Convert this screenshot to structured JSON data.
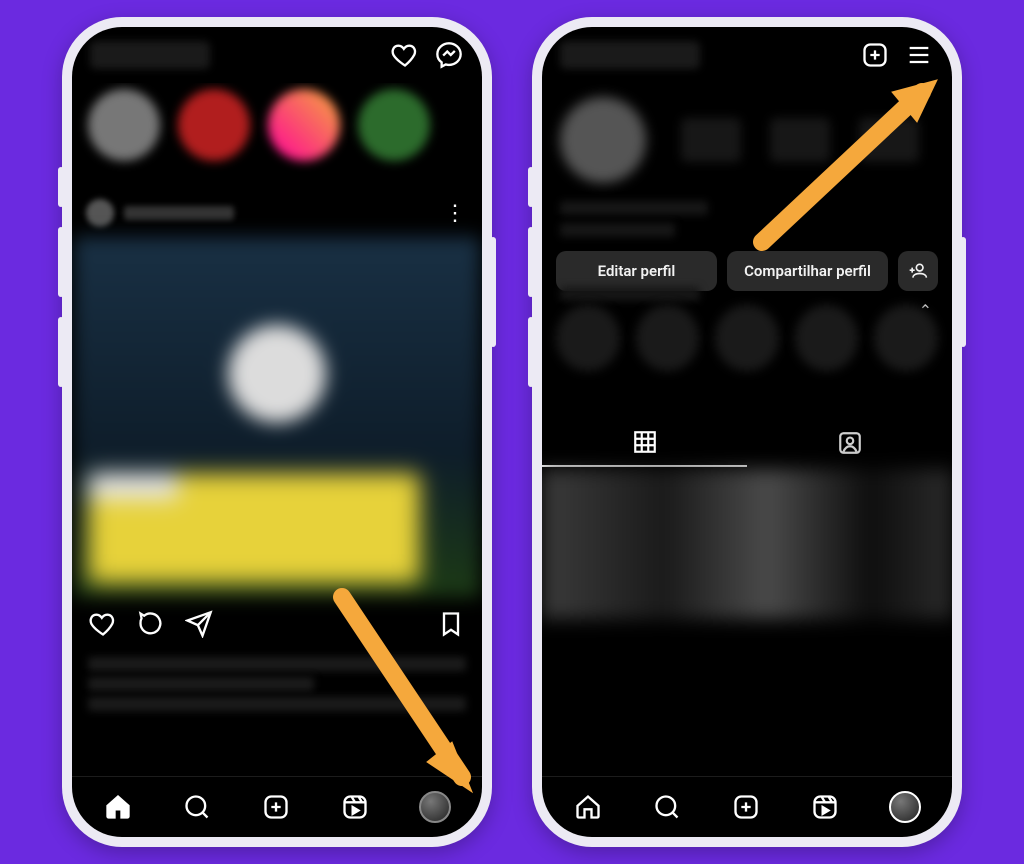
{
  "phone1": {
    "top": {
      "brand": "Instagram"
    },
    "nav": {
      "home": "Home",
      "search": "Search",
      "create": "Create",
      "reels": "Reels",
      "profile": "Profile"
    }
  },
  "phone2": {
    "buttons": {
      "edit": "Editar perfil",
      "share": "Compartilhar perfil"
    },
    "nav": {
      "home": "Home",
      "search": "Search",
      "create": "Create",
      "reels": "Reels",
      "profile": "Profile"
    }
  }
}
